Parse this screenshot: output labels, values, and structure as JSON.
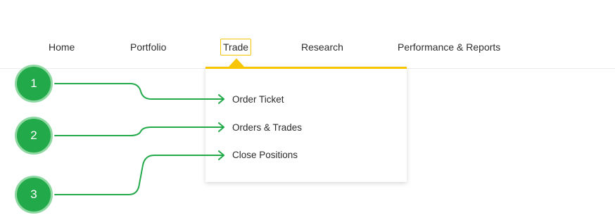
{
  "nav": {
    "items": [
      {
        "label": "Home"
      },
      {
        "label": "Portfolio"
      },
      {
        "label": "Trade"
      },
      {
        "label": "Research"
      },
      {
        "label": "Performance & Reports"
      }
    ],
    "active": "Trade"
  },
  "dropdown": {
    "items": [
      {
        "label": "Order Ticket"
      },
      {
        "label": "Orders & Trades"
      },
      {
        "label": "Close Positions"
      }
    ]
  },
  "callouts": [
    {
      "number": "1"
    },
    {
      "number": "2"
    },
    {
      "number": "3"
    }
  ],
  "colors": {
    "accent_yellow": "#f7c600",
    "callout_green": "#22a94a",
    "callout_ring": "#8fd8a2"
  }
}
